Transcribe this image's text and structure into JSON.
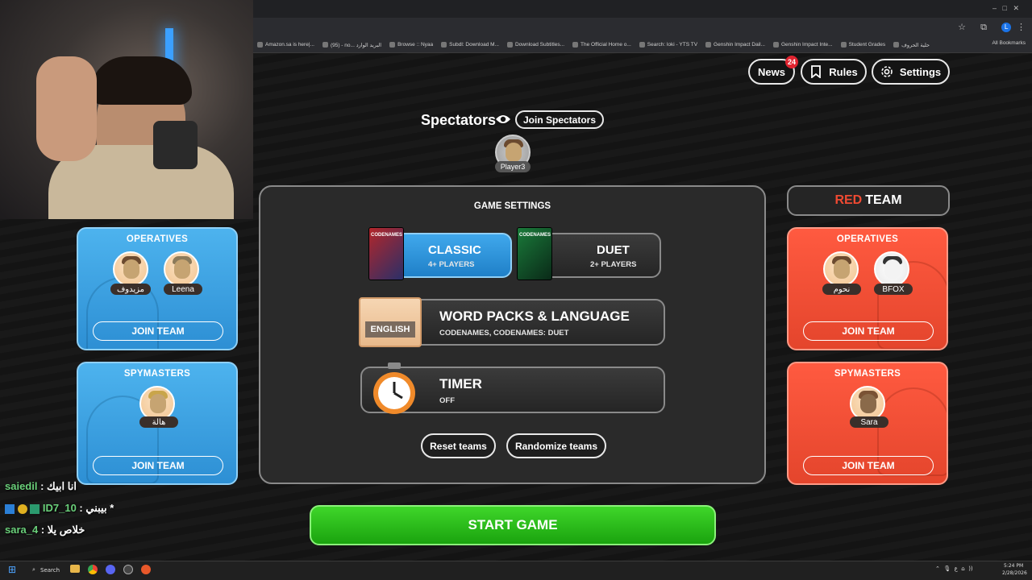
{
  "header": {
    "news_label": "News",
    "news_badge": "24",
    "rules_label": "Rules",
    "settings_label": "Settings"
  },
  "bookmarks": [
    "Amazon.sa is here|...",
    "(95) - no... البريد الوارد",
    "Browse :: Nyaa",
    "Subdl: Download M...",
    "Download Subtitles...",
    "The Official Home o...",
    "Search: loki - YTS TV",
    "Genshin Impact Dail...",
    "Genshin Impact Inte...",
    "Student Grades",
    "حلية الحروف"
  ],
  "all_bookmarks": "All Bookmarks",
  "spectators": {
    "title": "Spectators",
    "join_label": "Join Spectators",
    "players": [
      "Player3"
    ]
  },
  "blue_team": {
    "operatives_title": "OPERATIVES",
    "operatives": [
      "مزيدوف",
      "Leena"
    ],
    "operatives_join": "JOIN TEAM",
    "spymasters_title": "SPYMASTERS",
    "spymasters": [
      "هالة"
    ],
    "spymasters_join": "JOIN TEAM",
    "color": "#3aa3e6"
  },
  "red_team": {
    "header_red": "RED",
    "header_team": "TEAM",
    "operatives_title": "OPERATIVES",
    "operatives": [
      "نحوم",
      "BFOX"
    ],
    "operatives_join": "JOIN TEAM",
    "spymasters_title": "SPYMASTERS",
    "spymasters": [
      "Sara"
    ],
    "spymasters_join": "JOIN TEAM",
    "color": "#f04a32"
  },
  "game_settings": {
    "title": "GAME SETTINGS",
    "classic": {
      "label": "CLASSIC",
      "sub": "4+ PLAYERS"
    },
    "duet": {
      "label": "DUET",
      "sub": "2+ PLAYERS"
    },
    "word_packs": {
      "label": "WORD PACKS & LANGUAGE",
      "sub": "CODENAMES, CODENAMES: DUET",
      "language_card": "ENGLISH"
    },
    "timer": {
      "label": "TIMER",
      "sub": "OFF"
    },
    "reset_label": "Reset teams",
    "randomize_label": "Randomize teams",
    "box_label": "CODENAMES"
  },
  "start_label": "START GAME",
  "chat": [
    {
      "user": "saiedil",
      "sep": " : ",
      "msg": "انا ابيك"
    },
    {
      "user": "ID7_10",
      "sep": " : ",
      "msg": "بيبني *"
    },
    {
      "user": "sara_4",
      "sep": " : ",
      "msg": "خلاص يلا"
    }
  ],
  "taskbar": {
    "search_label": "Search",
    "time": "5:24 PM",
    "date": "2/28/2026"
  }
}
